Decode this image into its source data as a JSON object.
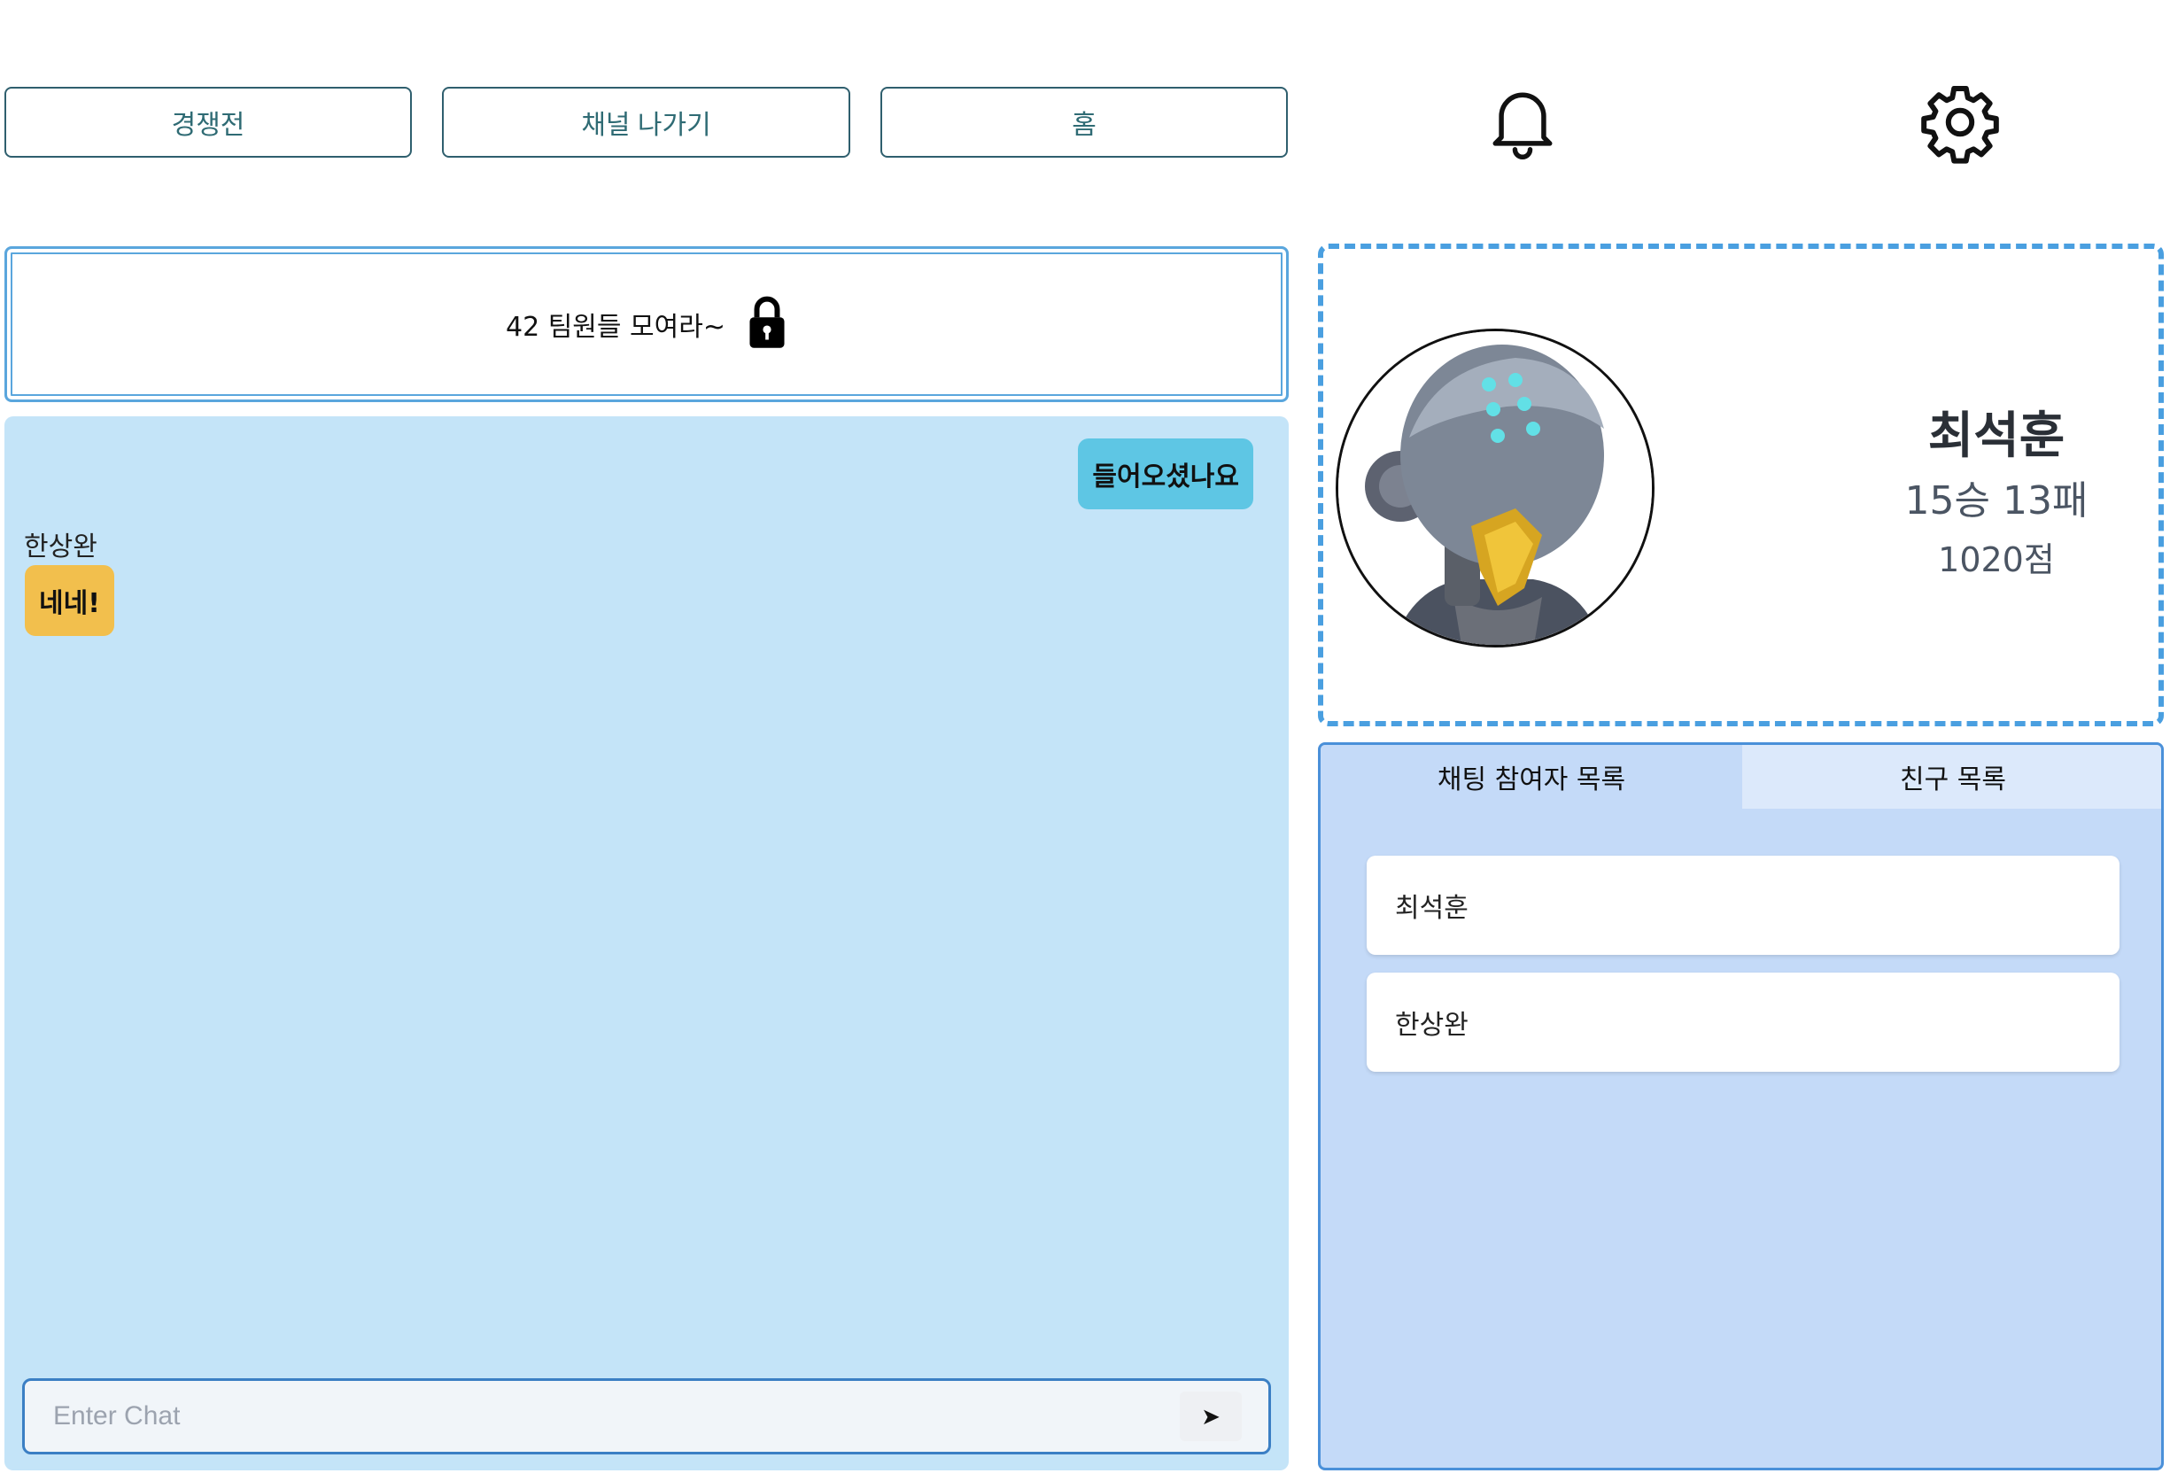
{
  "nav": {
    "buttons": [
      "경쟁전",
      "채널 나가기",
      "홈"
    ],
    "bell_icon": "bell-icon",
    "gear_icon": "gear-icon"
  },
  "channel": {
    "title": "42 팀원들 모여라~",
    "lock_icon": "lock-icon"
  },
  "chat": {
    "messages": [
      {
        "sender": "",
        "text": "들어오셨나요",
        "mine": true
      },
      {
        "sender": "한상완",
        "text": "네네!",
        "mine": false
      }
    ],
    "input_placeholder": "Enter Chat",
    "send_label": "➤"
  },
  "profile": {
    "name": "최석훈",
    "record": "15승 13패",
    "score": "1020점"
  },
  "participants": {
    "tabs": [
      "채팅 참여자 목록",
      "친구 목록"
    ],
    "active_tab": 0,
    "items": [
      "최석훈",
      "한상완"
    ]
  },
  "colors": {
    "chat_bg": "#c4e4f8",
    "my_bubble": "#5ec6e4",
    "other_bubble": "#f2bf4d",
    "list_bg": "#c4daf8",
    "accent_border": "#4a9fe0"
  }
}
